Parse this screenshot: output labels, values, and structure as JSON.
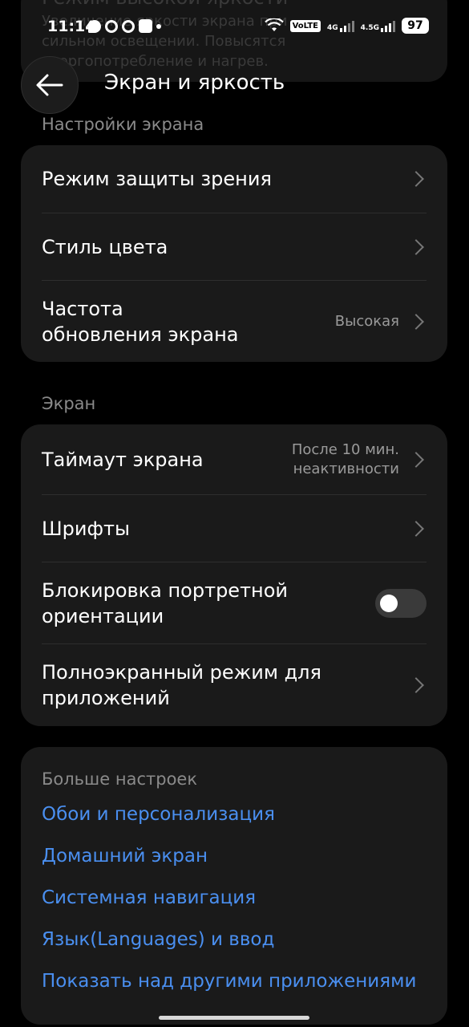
{
  "ghost": {
    "title": "Режим высокой яркости",
    "desc_line1": "Увеличение яркости экрана при",
    "desc_line2": "сильном освещении. Повысятся",
    "desc_line3": "энергопотребление и нагрев."
  },
  "status_bar": {
    "time": "11:14",
    "volte": "VoLTE",
    "net1": "4G",
    "net2": "4.5G",
    "battery": "97"
  },
  "header": {
    "title": "Экран и яркость",
    "back_icon": "arrow-left-icon"
  },
  "sections": {
    "screen_settings_label": "Настройки экрана",
    "screen_label": "Экран"
  },
  "screen_settings": {
    "eye_protection": "Режим защиты зрения",
    "color_style": "Стиль цвета",
    "refresh_rate_line1": "Частота",
    "refresh_rate_line2": "обновления экрана",
    "refresh_rate_value": "Высокая"
  },
  "screen": {
    "timeout": "Таймаут экрана",
    "timeout_value_line1": "После 10 мин.",
    "timeout_value_line2": "неактивности",
    "fonts": "Шрифты",
    "portrait_lock_line1": "Блокировка портретной",
    "portrait_lock_line2": "ориентации",
    "portrait_lock_on": false,
    "fullscreen_line1": "Полноэкранный режим для",
    "fullscreen_line2": "приложений"
  },
  "more": {
    "title": "Больше настроек",
    "links": [
      "Обои и персонализация",
      "Домашний экран",
      "Системная навигация",
      "Язык(Languages) и ввод",
      "Показать над другими приложениями"
    ]
  },
  "colors": {
    "accent_link": "#4a8ff0",
    "card_bg": "#1a1a1a",
    "background": "#000000"
  }
}
